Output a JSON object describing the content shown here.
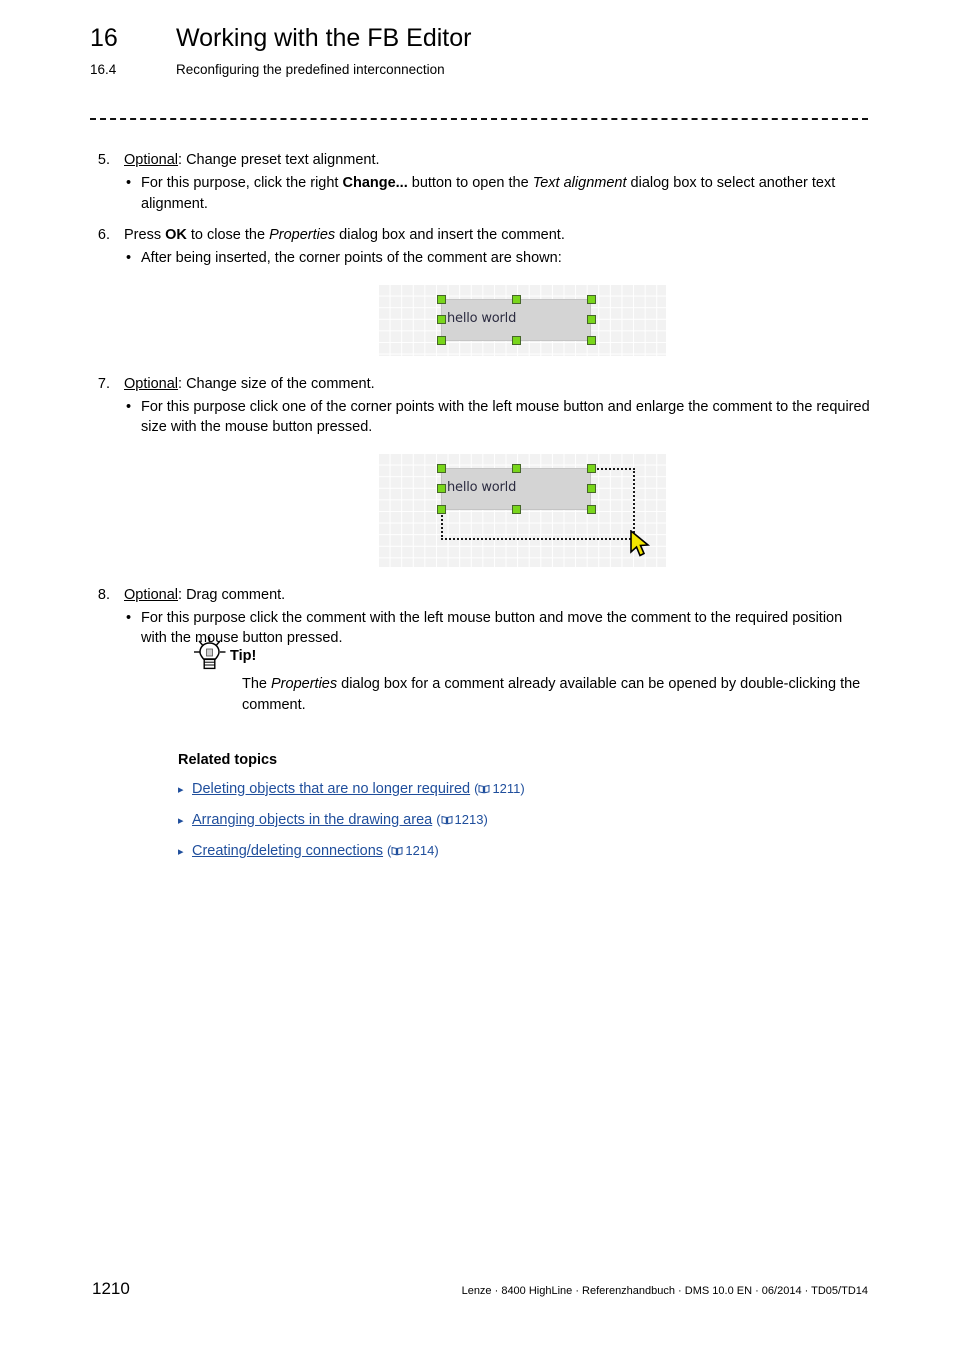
{
  "header": {
    "chapter_number": "16",
    "chapter_title": "Working with the FB Editor",
    "section_number": "16.4",
    "section_title": "Reconfiguring the predefined interconnection"
  },
  "steps": [
    {
      "number": "5.",
      "lead_underlined": "Optional",
      "lead_rest": ": Change preset text alignment.",
      "bullets": [
        {
          "p1": "For this purpose, click the right ",
          "bold": "Change...",
          "p2": " button to open the ",
          "italic": "Text alignment",
          "p3": " dialog box to select another text alignment."
        }
      ]
    },
    {
      "number": "6.",
      "p1": "Press ",
      "bold": "OK",
      "p2": " to close the ",
      "italic": "Properties",
      "p3": " dialog box and insert the comment.",
      "bullets": [
        {
          "plain": "After being inserted, the corner points of the comment are shown:"
        }
      ]
    },
    {
      "number": "7.",
      "lead_underlined": "Optional",
      "lead_rest": ": Change size of the comment.",
      "bullets": [
        {
          "plain": "For this purpose click one of the corner points with the left mouse button and enlarge the comment to the required size with the mouse button pressed."
        }
      ]
    },
    {
      "number": "8.",
      "lead_underlined": "Optional",
      "lead_rest": ": Drag comment.",
      "bullets": [
        {
          "plain": "For this purpose click the comment with the left mouse button and move the comment to the required position with the mouse button pressed."
        }
      ]
    }
  ],
  "figures": {
    "figure1": {
      "comment_text": "hello world",
      "caption_note": "comment with corner points shown"
    },
    "figure2": {
      "comment_text": "hello world",
      "caption_note": "comment being resized with rubber band and mouse cursor"
    }
  },
  "tip": {
    "label": "Tip!",
    "p1": "The ",
    "italic": "Properties",
    "p2": " dialog box for a comment already available can be opened by double-clicking the comment."
  },
  "related": {
    "title": "Related topics",
    "items": [
      {
        "link": "Deleting objects that are no longer required",
        "page": "1211"
      },
      {
        "link": "Arranging objects in the drawing area",
        "page": "1213"
      },
      {
        "link": "Creating/deleting connections",
        "page": "1214"
      }
    ]
  },
  "footer": {
    "page_number": "1210",
    "meta": "Lenze · 8400 HighLine · Referenzhandbuch · DMS 10.0 EN · 06/2014 · TD05/TD14"
  },
  "colors": {
    "link": "#1f4e9c",
    "handle_fill": "#79d61b",
    "handle_border": "#46662a",
    "comment_fill": "#d4d4d4",
    "grid_bg": "#f2f2f2",
    "cursor": "#f2e500"
  }
}
